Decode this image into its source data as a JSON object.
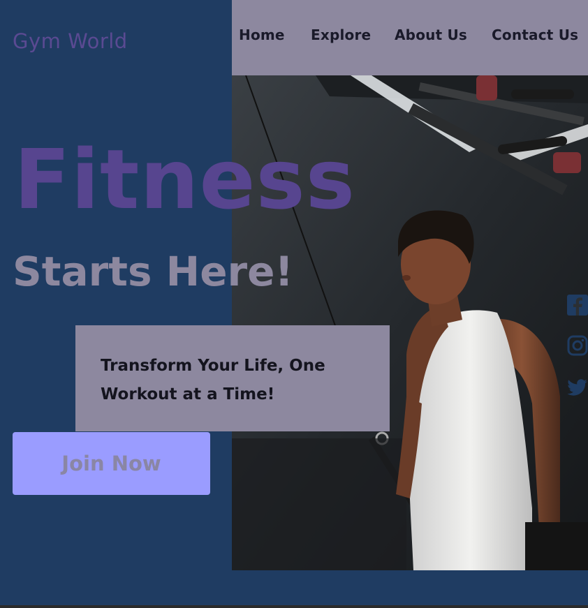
{
  "brand": {
    "name": "Gym World"
  },
  "nav": {
    "items": [
      {
        "label": "Home"
      },
      {
        "label": "Explore"
      },
      {
        "label": "About Us"
      },
      {
        "label": "Contact Us"
      }
    ]
  },
  "hero": {
    "title": "Fitness",
    "subtitle": "Starts Here!",
    "tagline": "Transform Your Life, One Workout at a Time!",
    "cta_label": "Join Now"
  },
  "social": {
    "icons": [
      "facebook-icon",
      "instagram-icon",
      "twitter-icon"
    ]
  },
  "colors": {
    "background": "#1f3c62",
    "nav_background": "#8d889f",
    "title": "#57458f",
    "subtitle": "#8d889f",
    "cta_background": "#9a9cff",
    "cta_text": "#8a86a4"
  }
}
